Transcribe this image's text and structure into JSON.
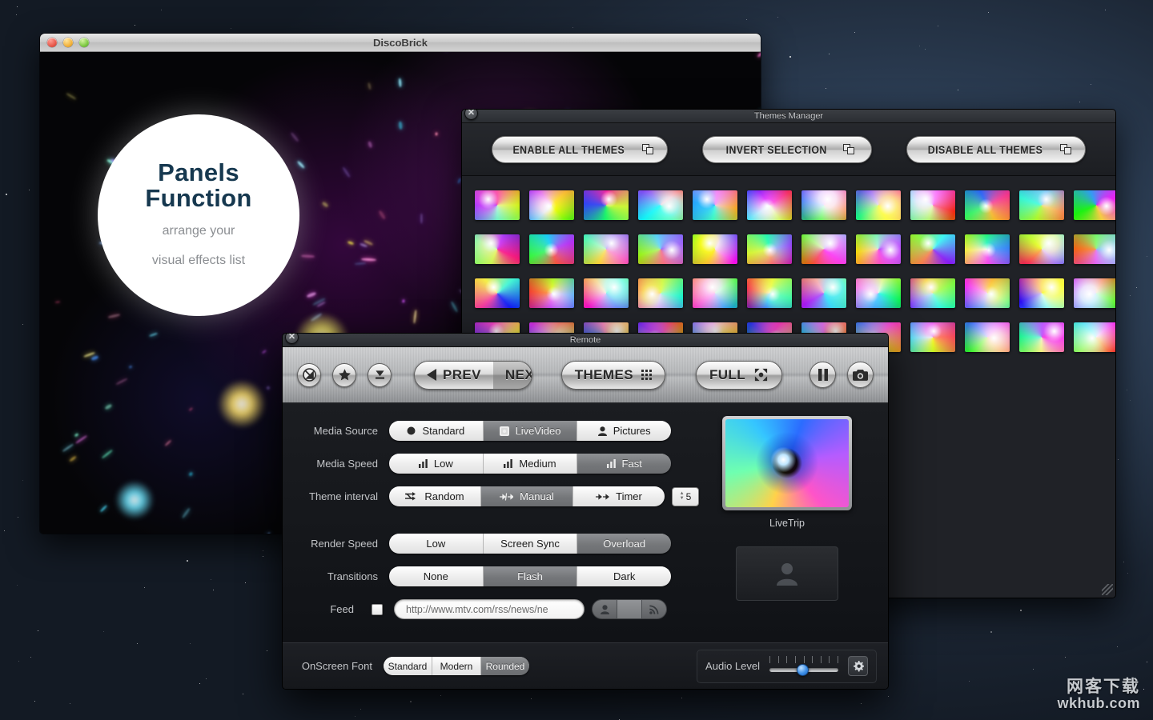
{
  "desktop": {
    "background_color": "#2b3c52"
  },
  "main_window": {
    "title": "DiscoBrick",
    "traffic_lights": [
      "close-button",
      "minimize-button",
      "zoom-button"
    ],
    "bubble": {
      "title_line1": "Panels",
      "title_line2": "Function",
      "sub_line1": "arrange your",
      "sub_line2": "visual effects list",
      "title_color": "#16384f",
      "sub_color": "#8b8e92"
    }
  },
  "themes_manager": {
    "title": "Themes Manager",
    "close_glyph": "✕",
    "buttons": [
      {
        "label": "ENABLE ALL THEMES",
        "icon": "copy-icon"
      },
      {
        "label": "INVERT SELECTION",
        "icon": "copy-icon"
      },
      {
        "label": "DISABLE ALL THEMES",
        "icon": "copy-icon"
      }
    ],
    "thumbnails": [
      "#b4309a",
      "#e8b400",
      "#1a1208",
      "#2ad6e0",
      "#1f7fd6",
      "#d63ad2",
      "#cfd8e6",
      "#d8d82a",
      "#e06ab0",
      "#2a2a38",
      "#2fbf4f",
      "#0d0d14",
      "#c21a4a",
      "#1a2a4a",
      "#b8896a",
      "#5a6676",
      "#f2d400",
      "#1f9c2f",
      "#d61ab4",
      "#b82fd6",
      "#23303f",
      "#2a4fb0",
      "#e0c000",
      "#8a6a3a",
      "#2a2f3a",
      "#c06a20",
      "#7fd2e0",
      "#9fd63a",
      "#c9a3e0",
      "#3fd64f",
      "#1f5fe0",
      "#2fa9e0",
      "#7fd63a",
      "#d6a03a",
      "#e0d62a",
      "#c0e0d6",
      "#1a3a6a",
      "#d6b89a",
      "#1f8a6a",
      "#b43ad6",
      "#e0b82a",
      "#d63a9a",
      "#e06a2a",
      "#b4724a",
      "#e0601a",
      "#c9c0a8",
      "#8a3ad6",
      "#9fd6a0",
      "#d63ad6",
      "#d6c62a",
      "#a8b8c0",
      "#3ae04f"
    ],
    "resize_grip": "resize-grip"
  },
  "remote": {
    "title": "Remote",
    "close_glyph": "✕",
    "toolbar": {
      "round_buttons": [
        {
          "name": "no-entry-icon"
        },
        {
          "name": "star-icon"
        },
        {
          "name": "eject-down-icon"
        }
      ],
      "prev_label": "PREV",
      "next_label": "NEXT",
      "themes_label": "THEMES",
      "full_label": "FULL",
      "pause_icon": "pause-icon",
      "camera_icon": "camera-icon"
    },
    "settings": [
      {
        "label": "Media Source",
        "selected": 1,
        "options": [
          {
            "text": "Standard",
            "icon": "circle-icon"
          },
          {
            "text": "LiveVideo",
            "icon": "video-icon"
          },
          {
            "text": "Pictures",
            "icon": "person-icon"
          }
        ]
      },
      {
        "label": "Media Speed",
        "selected": 2,
        "options": [
          {
            "text": "Low",
            "icon": "bars-icon"
          },
          {
            "text": "Medium",
            "icon": "bars-icon"
          },
          {
            "text": "Fast",
            "icon": "bars-icon"
          }
        ]
      },
      {
        "label": "Theme interval",
        "selected": 1,
        "options": [
          {
            "text": "Random",
            "icon": "shuffle-icon"
          },
          {
            "text": "Manual",
            "icon": "manual-arrow-icon"
          },
          {
            "text": "Timer",
            "icon": "timer-arrow-icon"
          }
        ],
        "stepper_value": "5"
      },
      {
        "label": "Render Speed",
        "selected": 2,
        "options": [
          {
            "text": "Low",
            "icon": ""
          },
          {
            "text": "Screen Sync",
            "icon": ""
          },
          {
            "text": "Overload",
            "icon": ""
          }
        ]
      },
      {
        "label": "Transitions",
        "selected": 1,
        "options": [
          {
            "text": "None",
            "icon": ""
          },
          {
            "text": "Flash",
            "icon": ""
          },
          {
            "text": "Dark",
            "icon": ""
          }
        ]
      }
    ],
    "feed": {
      "label": "Feed",
      "checkbox_checked": false,
      "url_value": "http://www.mtv.com/rss/news/ne",
      "url_placeholder": "http://",
      "segment_icons": [
        "person-icon",
        "blank",
        "rss-icon"
      ]
    },
    "preview": {
      "theme_name": "LiveTrip",
      "secondary_icon": "person-placeholder-icon"
    },
    "footer": {
      "font_label": "OnScreen Font",
      "font_selected": 2,
      "font_options": [
        "Standard",
        "Modern",
        "Rounded"
      ],
      "audio_label": "Audio Level",
      "audio_value_percent": 40,
      "gear_icon": "gear-icon"
    }
  },
  "watermark": {
    "cn": "网客下载",
    "en": "wkhub.com"
  }
}
